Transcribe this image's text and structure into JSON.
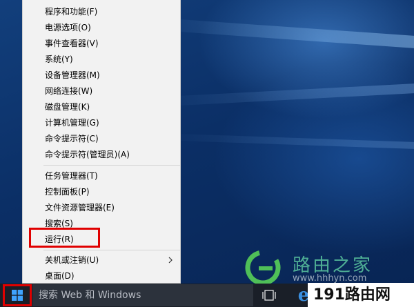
{
  "menu": {
    "items": [
      {
        "label": "程序和功能(F)"
      },
      {
        "label": "电源选项(O)"
      },
      {
        "label": "事件查看器(V)"
      },
      {
        "label": "系统(Y)"
      },
      {
        "label": "设备管理器(M)"
      },
      {
        "label": "网络连接(W)"
      },
      {
        "label": "磁盘管理(K)"
      },
      {
        "label": "计算机管理(G)"
      },
      {
        "label": "命令提示符(C)"
      },
      {
        "label": "命令提示符(管理员)(A)"
      },
      {
        "label": "任务管理器(T)"
      },
      {
        "label": "控制面板(P)"
      },
      {
        "label": "文件资源管理器(E)"
      },
      {
        "label": "搜索(S)"
      },
      {
        "label": "运行(R)"
      },
      {
        "label": "关机或注销(U)",
        "submenu_icon": "chevron-right-icon"
      },
      {
        "label": "桌面(D)"
      }
    ]
  },
  "taskbar": {
    "start_icon": "windows-logo-icon",
    "search_placeholder": "搜索 Web 和 Windows",
    "taskview_icon": "task-view-icon",
    "edge_icon": "edge-browser-icon",
    "edge_glyph": "e"
  },
  "watermark": {
    "name": "路由之家",
    "url": "www.hhhyn.com",
    "site": "191路由网"
  },
  "colors": {
    "menu_bg": "#f2f2f2",
    "highlight": "#e00000",
    "taskbar": "#1a1f28",
    "desktop": "#0b2f66"
  }
}
